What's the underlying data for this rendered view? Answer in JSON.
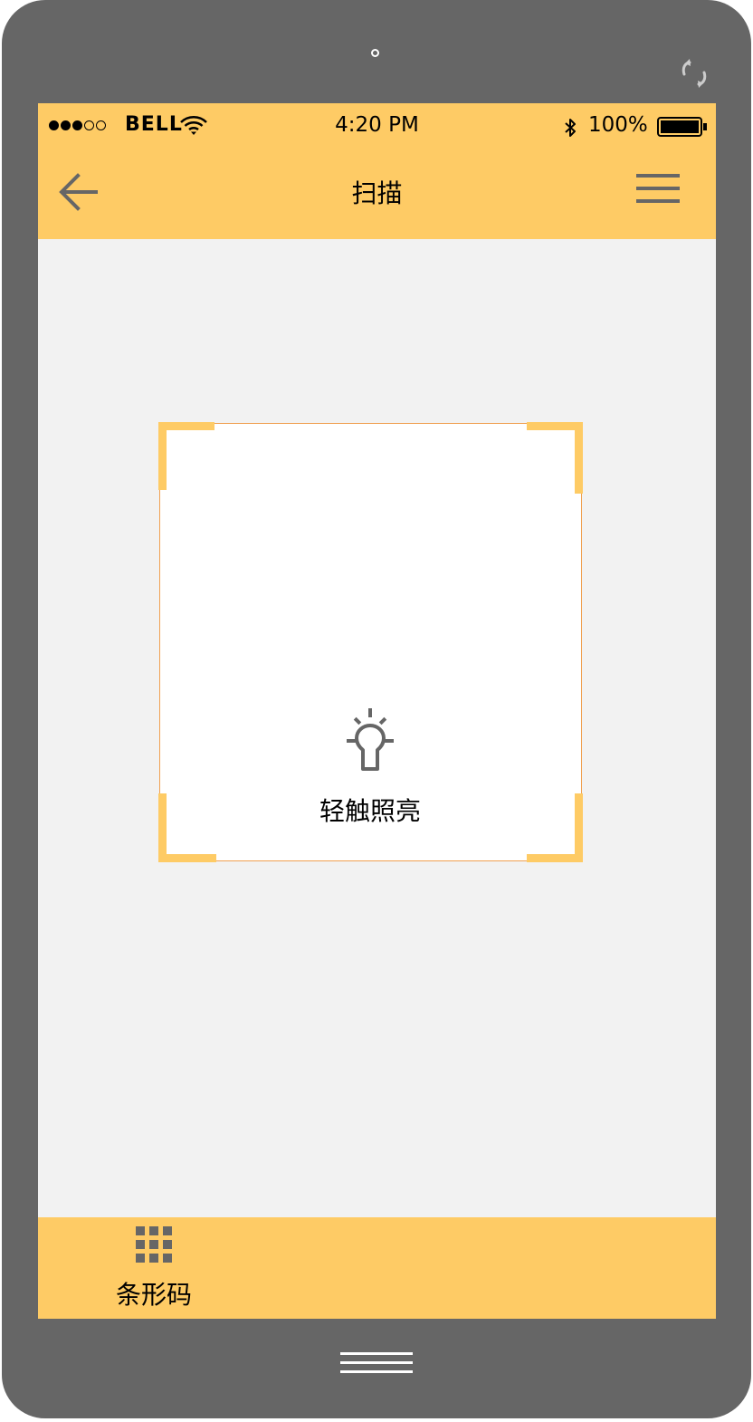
{
  "status_bar": {
    "carrier": "BELL",
    "time": "4:20 PM",
    "battery": "100%",
    "signal_bars": 3,
    "signal_total": 5
  },
  "nav": {
    "title": "扫描",
    "back_icon": "arrow-left-icon",
    "menu_icon": "hamburger-menu-icon"
  },
  "scanner": {
    "light_label": "轻触照亮",
    "light_icon": "lightbulb-icon"
  },
  "tab_bar": {
    "items": [
      {
        "label": "条形码",
        "icon": "grid-icon"
      }
    ]
  },
  "colors": {
    "accent": "#fecb65",
    "device": "#666666",
    "screen_bg": "#f2f2f2",
    "scan_border": "#f0a050",
    "icon_gray": "#666666"
  }
}
